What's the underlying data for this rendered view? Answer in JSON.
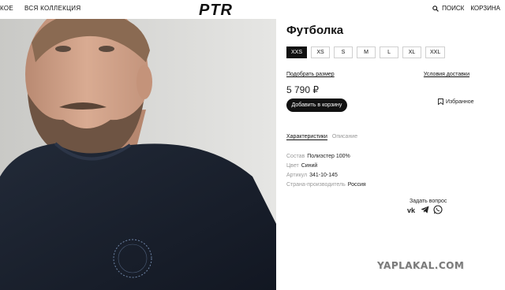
{
  "header": {
    "nav_left": [
      "КОЕ",
      "ВСЯ КОЛЛЕКЦИЯ"
    ],
    "logo_text": "PTR",
    "search_label": "ПОИСК",
    "cart_label": "КОРЗИНА"
  },
  "product": {
    "title": "Футболка",
    "sizes": [
      "XXS",
      "XS",
      "S",
      "M",
      "L",
      "XL",
      "XXL"
    ],
    "selected_size": "XXS",
    "size_guide_link": "Подобрать размер",
    "delivery_link": "Условия доставки",
    "price": "5 790 ₽",
    "add_to_cart": "Добавить в корзину",
    "favorite": "Избранное"
  },
  "tabs": [
    {
      "label": "Характеристики",
      "active": true
    },
    {
      "label": "Описание",
      "active": false
    }
  ],
  "specs": [
    {
      "label": "Состав",
      "value": "Полиэстер 100%"
    },
    {
      "label": "Цвет",
      "value": "Синий"
    },
    {
      "label": "Артикул",
      "value": "341-10-145"
    },
    {
      "label": "Страна-производитель",
      "value": "Россия"
    }
  ],
  "contact": {
    "ask_question": "Задать вопрос",
    "socials": [
      "vk-icon",
      "telegram-icon",
      "whatsapp-icon"
    ]
  },
  "watermark": "YAPLAKAL.COM",
  "colors": {
    "button_bg": "#111111",
    "shirt": "#1c2230",
    "photo_bg": "#d9d9d7"
  }
}
